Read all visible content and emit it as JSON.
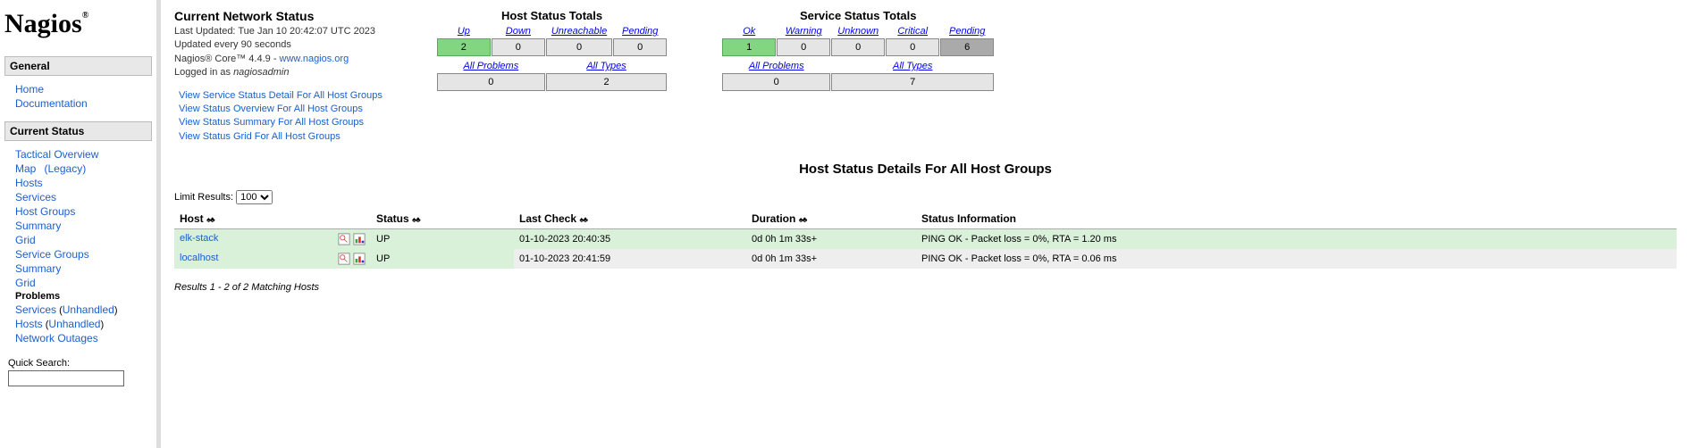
{
  "logo": "Nagios",
  "sidebar": {
    "sections": [
      {
        "title": "General",
        "items": [
          "Home",
          "Documentation"
        ]
      },
      {
        "title": "Current Status",
        "items": []
      }
    ],
    "current_status": {
      "tactical": "Tactical Overview",
      "map": "Map",
      "map_legacy": "(Legacy)",
      "hosts": "Hosts",
      "services": "Services",
      "host_groups": "Host Groups",
      "summary": "Summary",
      "grid": "Grid",
      "service_groups": "Service Groups",
      "problems": "Problems",
      "problems_services": "Services",
      "problems_unhandled": "Unhandled",
      "problems_hosts": "Hosts",
      "network_outages": "Network Outages"
    },
    "quick_search_label": "Quick Search:"
  },
  "status": {
    "title": "Current Network Status",
    "last_updated": "Last Updated: Tue Jan 10 20:42:07 UTC 2023",
    "update_interval": "Updated every 90 seconds",
    "core_pre": "Nagios® Core™ 4.4.9 - ",
    "core_link": "www.nagios.org",
    "login_pre": "Logged in as ",
    "login_user": "nagiosadmin",
    "links": [
      "View Service Status Detail For All Host Groups",
      "View Status Overview For All Host Groups",
      "View Status Summary For All Host Groups",
      "View Status Grid For All Host Groups"
    ]
  },
  "host_totals": {
    "title": "Host Status Totals",
    "headers": [
      "Up",
      "Down",
      "Unreachable",
      "Pending"
    ],
    "values": [
      "2",
      "0",
      "0",
      "0"
    ],
    "sub_headers": [
      "All Problems",
      "All Types"
    ],
    "sub_values": [
      "0",
      "2"
    ]
  },
  "service_totals": {
    "title": "Service Status Totals",
    "headers": [
      "Ok",
      "Warning",
      "Unknown",
      "Critical",
      "Pending"
    ],
    "values": [
      "1",
      "0",
      "0",
      "0",
      "6"
    ],
    "sub_headers": [
      "All Problems",
      "All Types"
    ],
    "sub_values": [
      "0",
      "7"
    ]
  },
  "detail": {
    "title": "Host Status Details For All Host Groups",
    "limit_label": "Limit Results:",
    "limit_value": "100",
    "columns": [
      "Host",
      "Status",
      "Last Check",
      "Duration",
      "Status Information"
    ],
    "rows": [
      {
        "host": "elk-stack",
        "status": "UP",
        "last_check": "01-10-2023 20:40:35",
        "duration": "0d 0h 1m 33s+",
        "info": "PING OK - Packet loss = 0%, RTA = 1.20 ms"
      },
      {
        "host": "localhost",
        "status": "UP",
        "last_check": "01-10-2023 20:41:59",
        "duration": "0d 0h 1m 33s+",
        "info": "PING OK - Packet loss = 0%, RTA = 0.06 ms"
      }
    ],
    "results_count": "Results 1 - 2 of 2 Matching Hosts"
  }
}
